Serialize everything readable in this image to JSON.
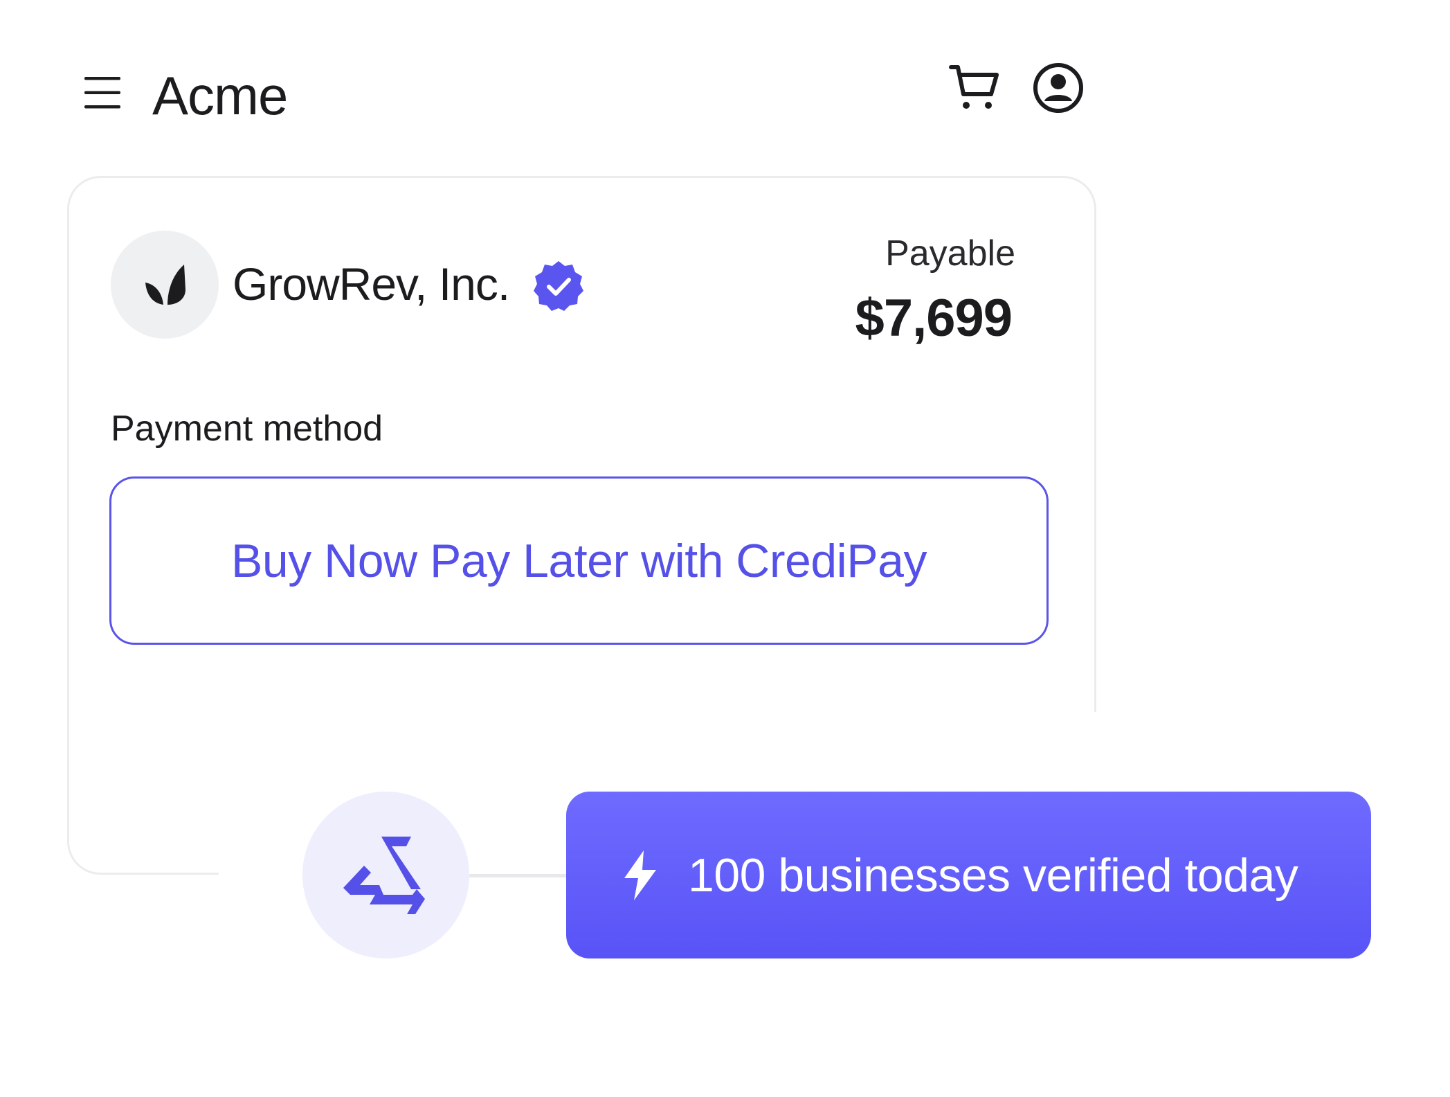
{
  "header": {
    "brand": "Acme",
    "menu_icon": "hamburger-menu-icon",
    "cart_icon": "shopping-cart-icon",
    "account_icon": "user-account-icon"
  },
  "checkout_card": {
    "company": {
      "name": "GrowRev, Inc.",
      "logo_icon": "leaf-logo-icon",
      "verified_icon": "verified-badge-icon"
    },
    "payable": {
      "label": "Payable",
      "amount": "$7,699"
    },
    "payment_method": {
      "label": "Payment method",
      "option_label": "Buy Now Pay Later with CrediPay"
    }
  },
  "notification": {
    "badge_icon": "credipay-logo-icon",
    "bolt_icon": "lightning-bolt-icon",
    "text": "100 businesses verified today"
  },
  "colors": {
    "accent": "#5450e8",
    "banner_top": "#6f6bff",
    "banner_bottom": "#5853f6",
    "badge_bg": "#eeeefd",
    "avatar_bg": "#eef0f2",
    "card_border": "#ececee"
  }
}
